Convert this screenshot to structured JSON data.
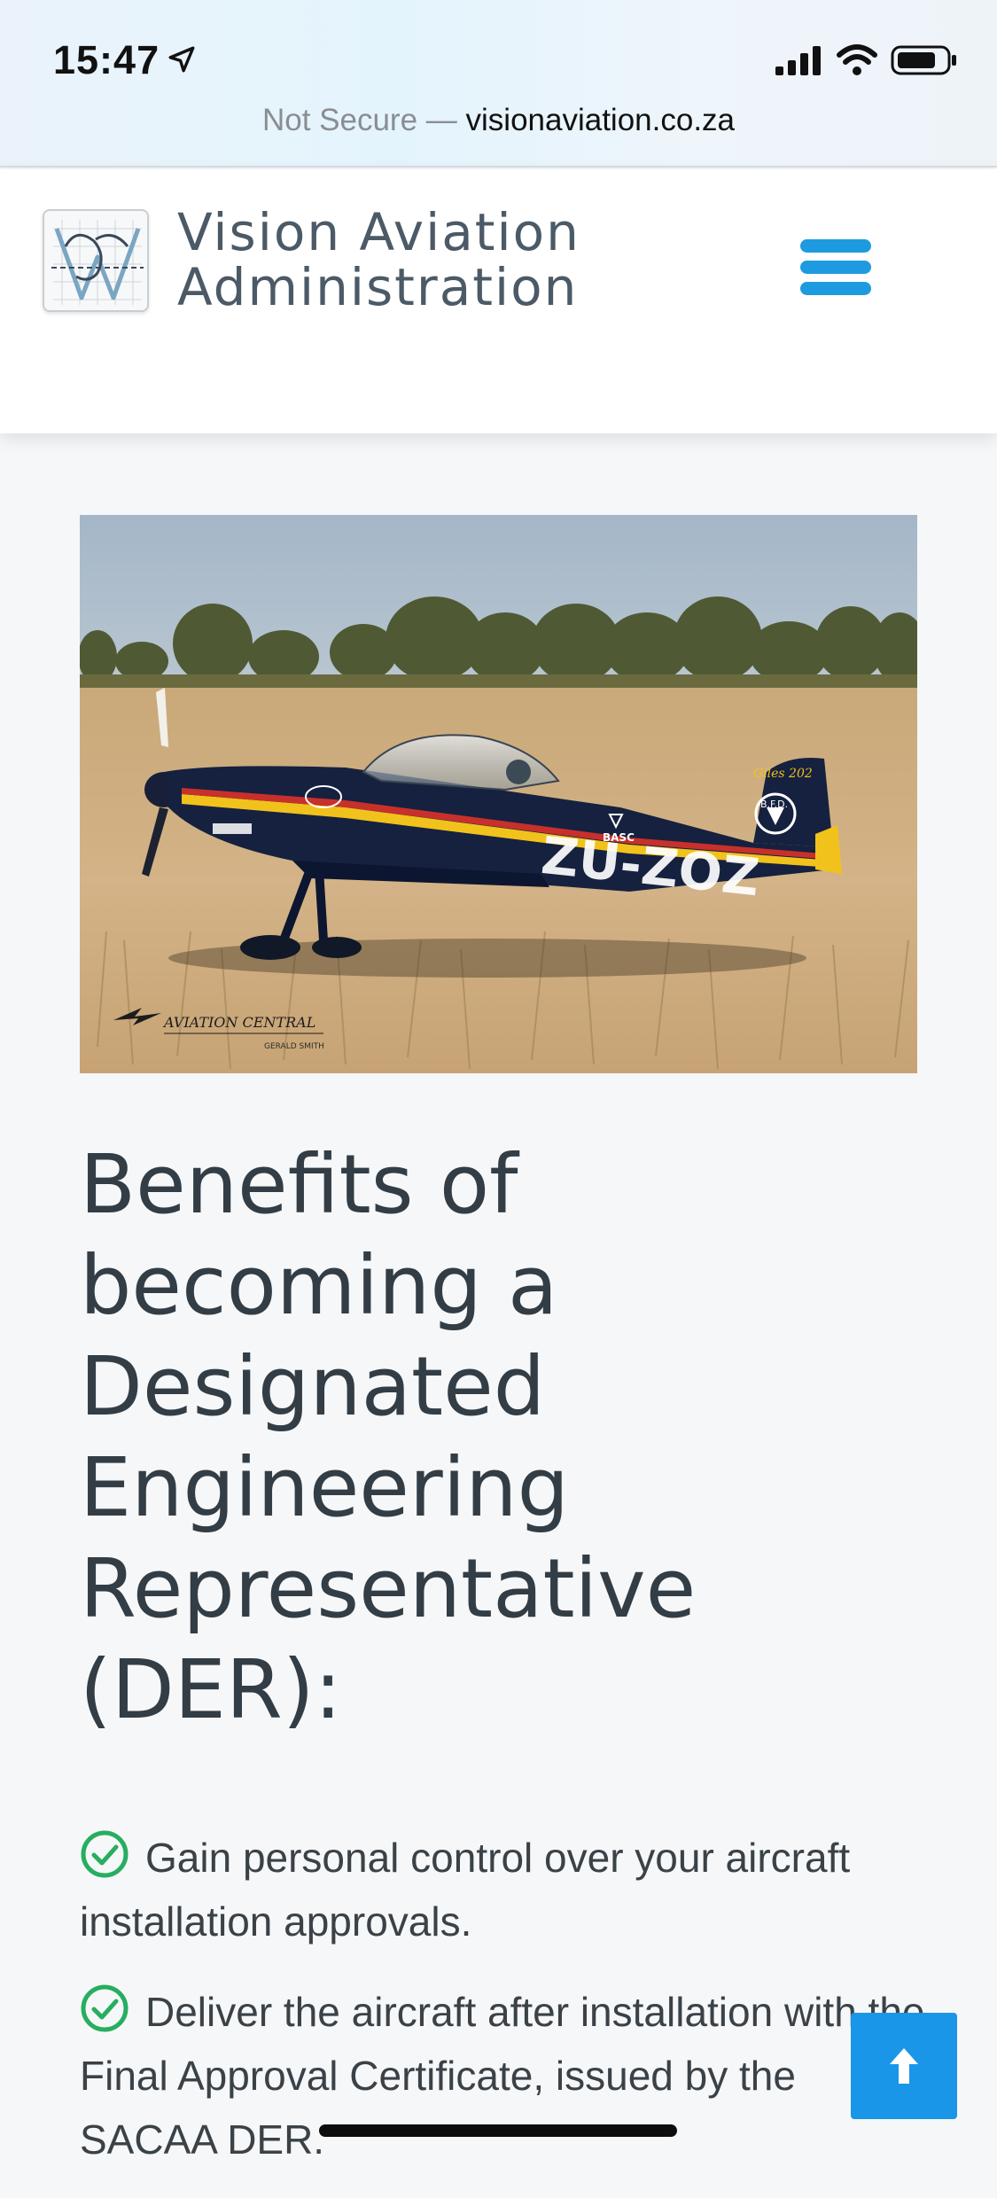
{
  "status_bar": {
    "time": "15:47"
  },
  "browser": {
    "security_label": "Not Secure —",
    "url": "visionaviation.co.za"
  },
  "header": {
    "brand_line1": "Vision Aviation",
    "brand_line2": "Administration"
  },
  "hero_image": {
    "registration": "ZU-ZOZ",
    "tail_text": "Giles 202",
    "tail_badge": "B.F.D.",
    "fuselage_badge": "BASC",
    "watermark": "AVIATION CENTRAL",
    "photographer": "GERALD SMITH"
  },
  "main": {
    "heading_lines": [
      "Benefits of",
      "becoming a",
      "Designated",
      "Engineering",
      "Representative",
      "(DER):"
    ],
    "benefits": [
      "Gain personal control over your aircraft installation approvals.",
      "Deliver the aircraft after installation with the Final Approval Certificate, issued by the SACAA DER."
    ]
  },
  "colors": {
    "accent": "#1e9be0",
    "check_green": "#27ae60",
    "heading": "#333d45",
    "brand_text": "#4b5a66"
  },
  "icons": {
    "menu": "hamburger-icon",
    "back_to_top": "arrow-up-icon",
    "benefit": "check-circle-icon"
  }
}
